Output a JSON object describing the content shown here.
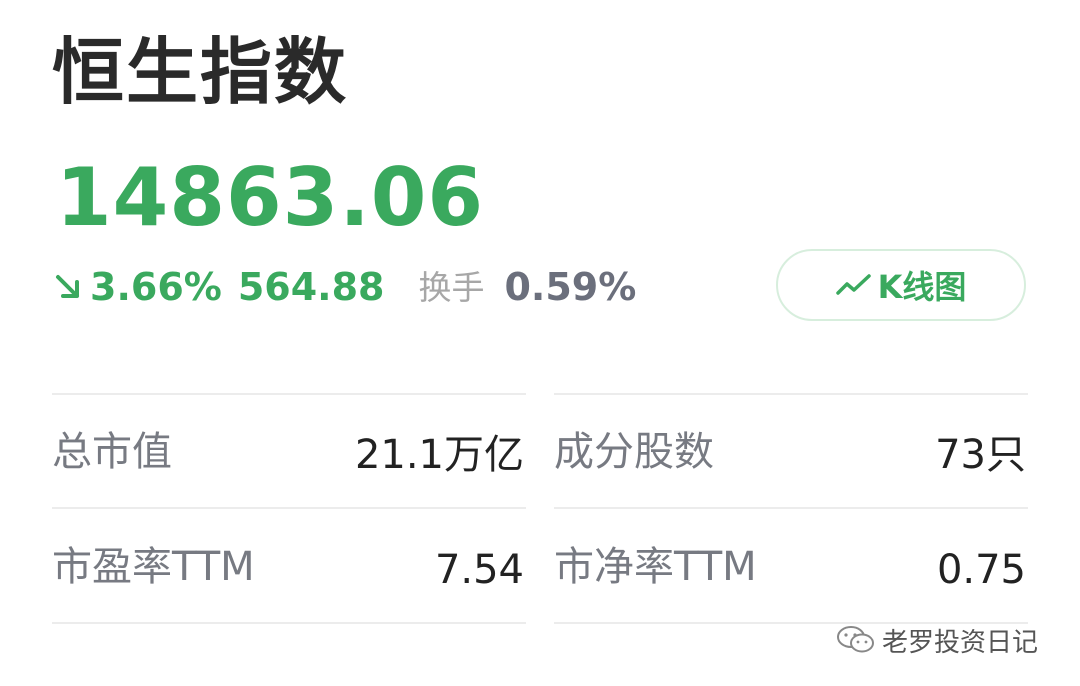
{
  "index": {
    "name": "恒生指数",
    "price": "14863.06",
    "change_percent": "3.66%",
    "change_amount": "564.88",
    "direction": "down",
    "turnover_label": "换手",
    "turnover_value": "0.59%"
  },
  "kline_button": {
    "label": "K线图",
    "icon": "trend-line-icon"
  },
  "stats": {
    "total_market_cap": {
      "label": "总市值",
      "value": "21.1万亿"
    },
    "constituents": {
      "label": "成分股数",
      "value": "73只"
    },
    "pe_ttm": {
      "label": "市盈率TTM",
      "value": "7.54"
    },
    "pb_ttm": {
      "label": "市净率TTM",
      "value": "0.75"
    }
  },
  "watermark": {
    "text": "老罗投资日记",
    "icon": "wechat-icon"
  },
  "colors": {
    "accent_green": "#3aa95e",
    "text_dark": "#2a2a2a",
    "text_grey": "#777a82"
  }
}
